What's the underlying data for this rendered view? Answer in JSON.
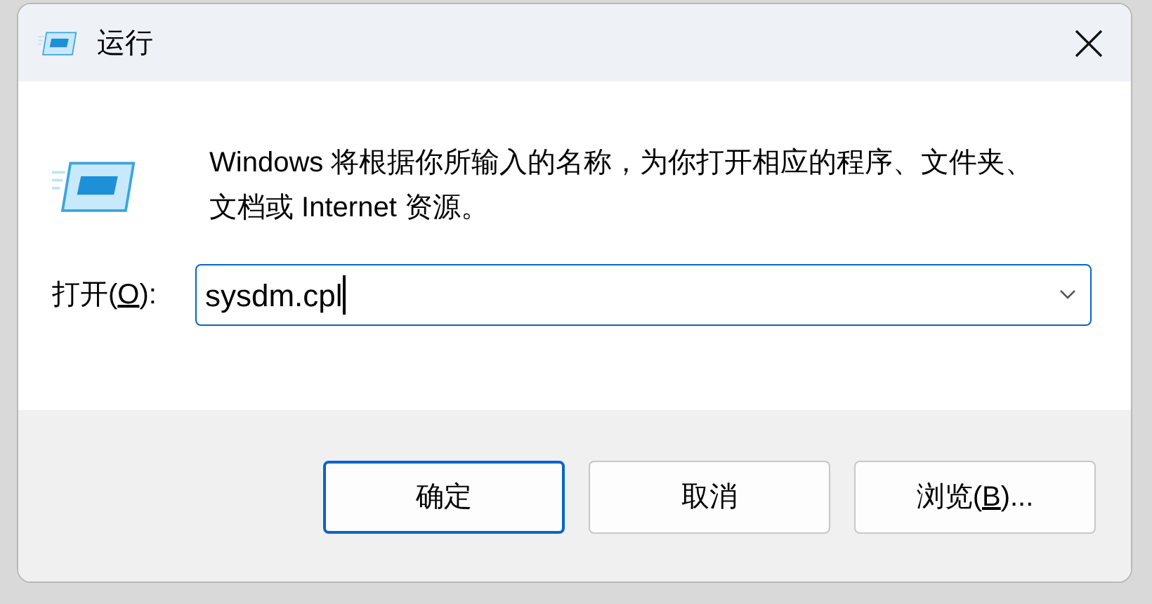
{
  "window": {
    "title": "运行"
  },
  "description": "Windows 将根据你所输入的名称，为你打开相应的程序、文件夹、文档或 Internet 资源。",
  "open_field": {
    "label": {
      "before": "打开(",
      "mnemonic": "O",
      "after": "):"
    },
    "value": "sysdm.cpl"
  },
  "buttons": [
    {
      "label": {
        "before": "确定"
      },
      "default": true
    },
    {
      "label": {
        "before": "取消"
      },
      "default": false
    },
    {
      "label": {
        "before": "浏览(",
        "mnemonic": "B",
        "after": ")..."
      },
      "default": false
    }
  ]
}
